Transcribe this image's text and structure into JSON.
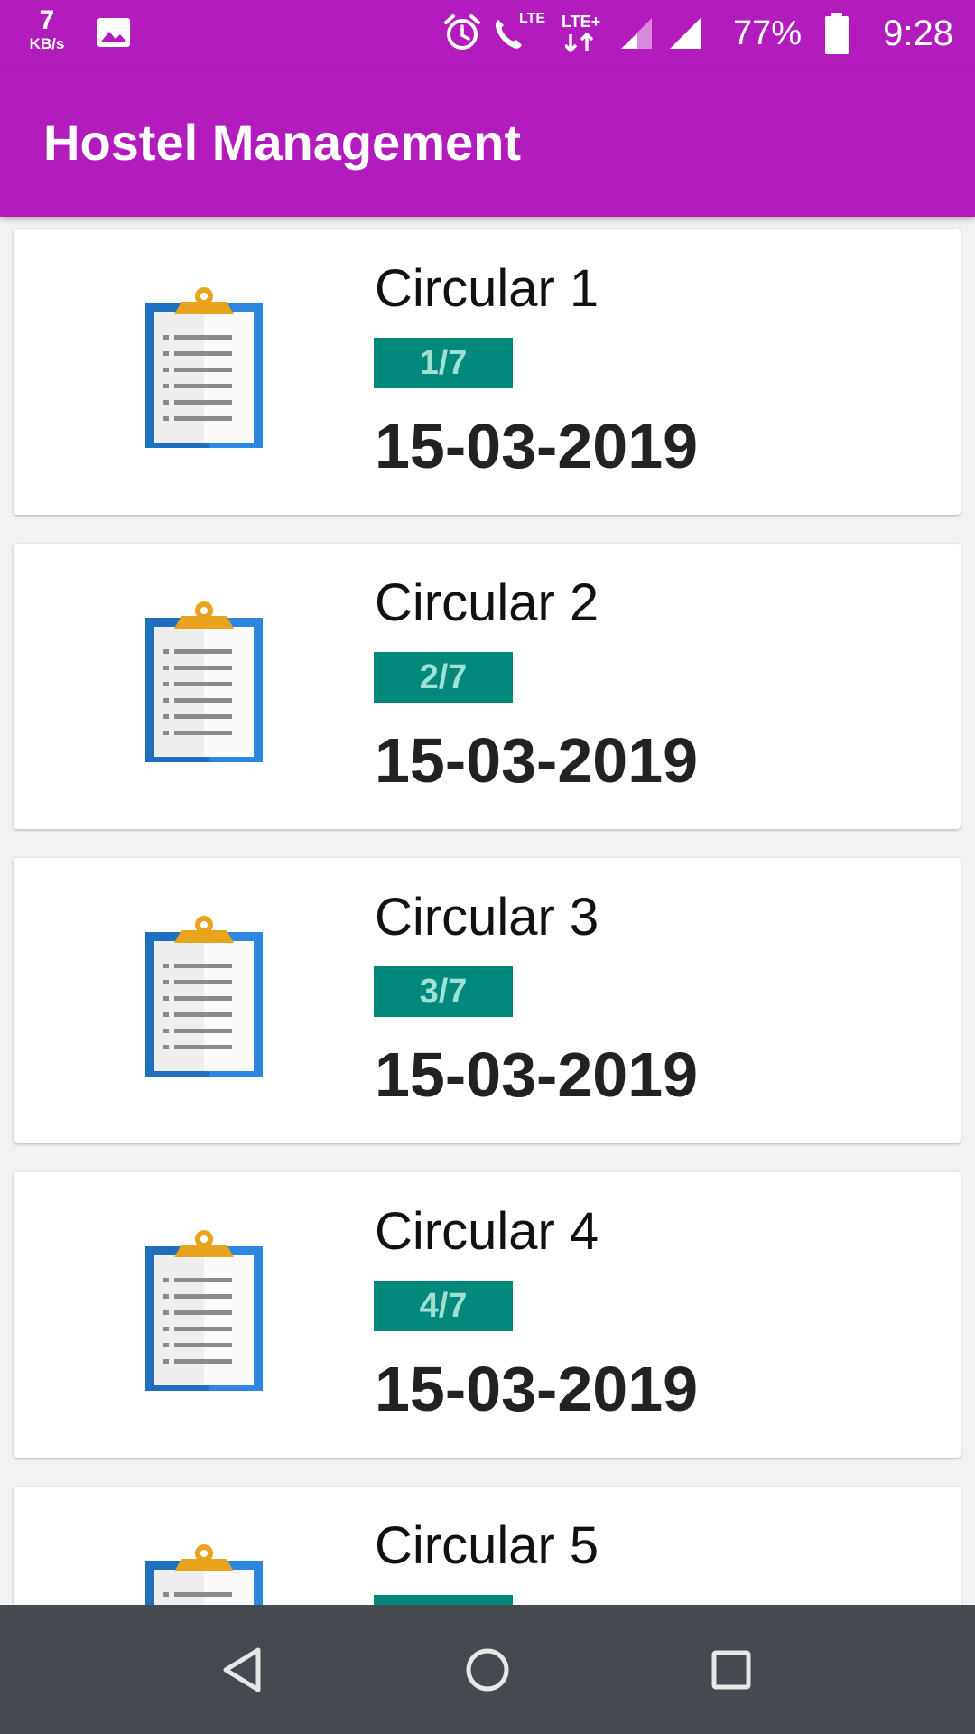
{
  "status_bar": {
    "net_speed_value": "7",
    "net_speed_unit": "KB/s",
    "call_network": "LTE",
    "data_network": "LTE+",
    "battery_percent": "77%",
    "battery_level": 0.77,
    "time": "9:28",
    "icons": [
      "gallery-icon",
      "alarm-icon",
      "volte-call-icon",
      "data-arrows-icon",
      "signal-icon",
      "signal-icon",
      "battery-icon"
    ]
  },
  "app_bar": {
    "title": "Hostel Management"
  },
  "colors": {
    "primary": "#b21cbc",
    "badge": "#00897b",
    "badge_text": "#9fe0d2",
    "nav_bar": "#454a50"
  },
  "circulars": [
    {
      "title": "Circular 1",
      "badge": "1/7",
      "date": "15-03-2019",
      "icon": "clipboard-icon"
    },
    {
      "title": "Circular 2",
      "badge": "2/7",
      "date": "15-03-2019",
      "icon": "clipboard-icon"
    },
    {
      "title": "Circular 3",
      "badge": "3/7",
      "date": "15-03-2019",
      "icon": "clipboard-icon"
    },
    {
      "title": "Circular 4",
      "badge": "4/7",
      "date": "15-03-2019",
      "icon": "clipboard-icon"
    },
    {
      "title": "Circular 5",
      "badge": "",
      "date": "",
      "icon": "clipboard-icon"
    }
  ],
  "nav_bar": {
    "buttons": [
      "back-icon",
      "home-icon",
      "recents-icon"
    ]
  }
}
